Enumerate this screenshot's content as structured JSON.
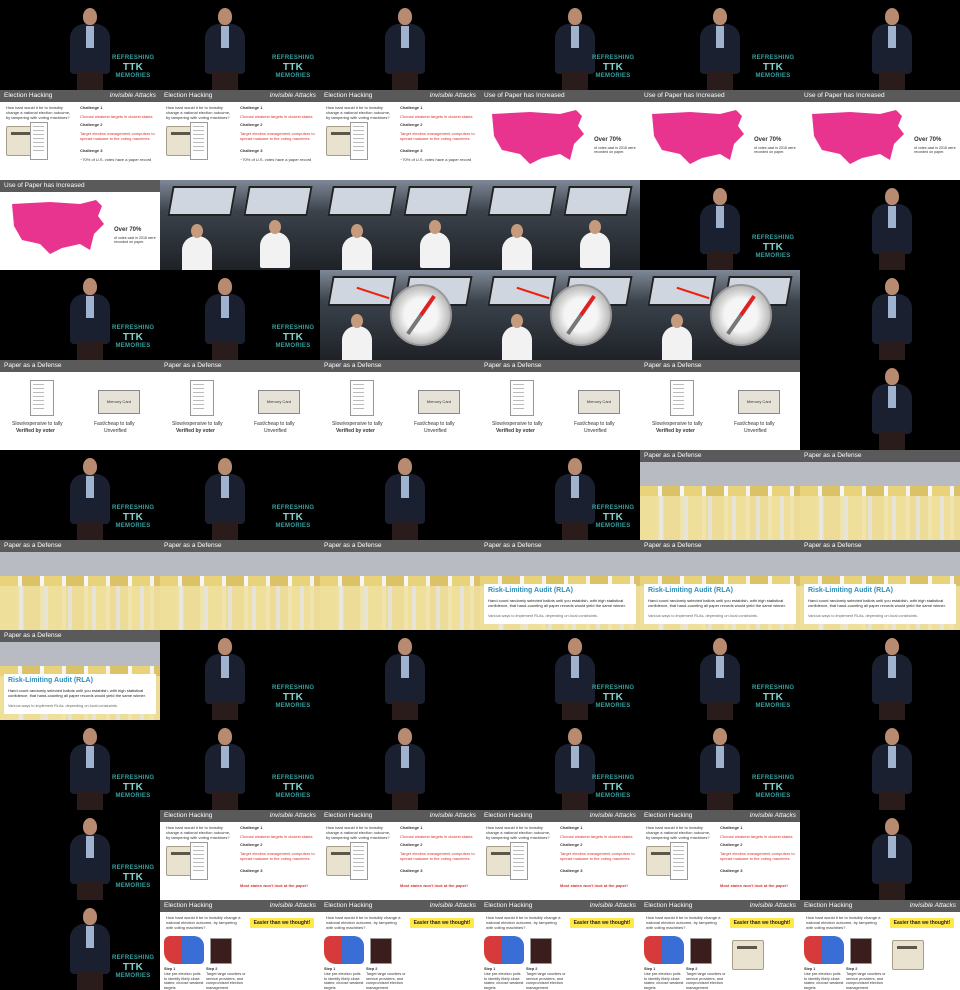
{
  "layout": {
    "columns": 6,
    "rows": 11
  },
  "texts": {
    "election_hacking": "Election Hacking",
    "invisible_attacks": "Invisible Attacks",
    "use_of_paper": "Use of Paper has Increased",
    "paper_defense": "Paper as a Defense",
    "question": "How hard would it be to invisibly change a national election outcome, by tampering with voting machines?",
    "challenge1": "Challenge 1",
    "challenge1_text": "Choose weakest targets in closest states",
    "challenge2": "Challenge 2",
    "challenge2_text": "Target election management computers to spread malware to the voting machines",
    "challenge3": "Challenge 3",
    "challenge3_text": "~70% of U.S. votes have a paper record",
    "most_states": "Most states won't look at the paper!",
    "over70": "Over 70%",
    "over70_sub": "of votes cast in 2016 were recorded on paper.",
    "memory_card": "Memory Card",
    "slow_expensive": "Slow/expensive to tally",
    "verified_by_voter": "Verified by voter",
    "fast_cheap": "Fast/cheap to tally",
    "unverified": "Unverified",
    "rla_title": "Risk-Limiting Audit (RLA)",
    "rla_body": "Hand count randomly selected ballots until you establish, with high statistical confidence, that hand-counting all paper records would yield the same winner.",
    "rla_note": "Various ways to implement RLAs, depending on local constraints.",
    "easier": "Easier than we thought!",
    "step1": "Step 1",
    "step1_text": "Use pre-election polls to identify likely close states; choose weakest targets",
    "step2": "Step 2",
    "step2_text": "Target large counties or service providers, and compromised election management computers",
    "logo_top": "REFRESHING",
    "logo_mid": "TTK",
    "logo_bottom": "MEMORIES"
  },
  "colors": {
    "map_magenta": "#e8348e",
    "rla_blue": "#2b8fbd",
    "challenge_red": "#d93030",
    "highlight_yellow": "#ffe94a"
  },
  "frames": [
    "speaker",
    "speaker",
    "speaker",
    "speaker",
    "speaker",
    "speaker",
    "election",
    "election",
    "election",
    "map",
    "map",
    "map",
    "map",
    "cockpit",
    "cockpit",
    "cockpit",
    "speaker",
    "speaker",
    "speaker",
    "speaker",
    "compass",
    "compass",
    "compass",
    "speaker",
    "paper",
    "paper",
    "paper",
    "paper",
    "paper",
    "speaker",
    "speaker",
    "speaker",
    "speaker",
    "speaker",
    "stacks",
    "stacks",
    "stacks",
    "stacks",
    "stacks",
    "rla",
    "rla",
    "rla",
    "rla",
    "speaker",
    "speaker",
    "speaker",
    "speaker",
    "speaker",
    "speaker",
    "speaker",
    "speaker",
    "speaker",
    "speaker",
    "speaker",
    "speaker",
    "election2",
    "election2",
    "election2",
    "election2",
    "speaker",
    "speaker",
    "easier",
    "easier",
    "easier",
    "easier2",
    "easier2"
  ]
}
